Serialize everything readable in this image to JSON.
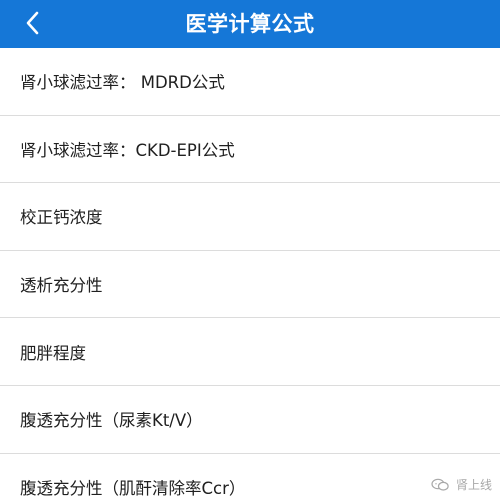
{
  "header": {
    "back_icon": "chevron-left-icon",
    "title": "医学计算公式",
    "background_color": "#1577d7"
  },
  "list": {
    "items": [
      {
        "label": "肾小球滤过率： MDRD公式"
      },
      {
        "label": "肾小球滤过率：CKD-EPI公式"
      },
      {
        "label": "校正钙浓度"
      },
      {
        "label": "透析充分性"
      },
      {
        "label": "肥胖程度"
      },
      {
        "label": "腹透充分性（尿素Kt/V）"
      },
      {
        "label": "腹透充分性（肌酐清除率Ccr）"
      }
    ]
  },
  "watermark": {
    "icon": "chat-bubbles-icon",
    "text": "肾上线"
  }
}
